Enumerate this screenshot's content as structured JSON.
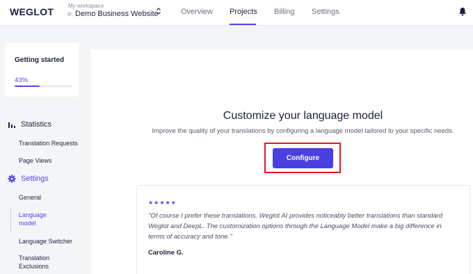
{
  "brand": {
    "logo_text": "WEGLOT"
  },
  "workspace": {
    "caption": "My workspace",
    "name": "Demo Business Website"
  },
  "nav": {
    "tabs": [
      {
        "label": "Overview"
      },
      {
        "label": "Projects"
      },
      {
        "label": "Billing"
      },
      {
        "label": "Settings"
      }
    ],
    "active_tab": "Projects"
  },
  "progress": {
    "title": "Getting started",
    "percent_label": "43%",
    "value": 0.43
  },
  "sidebar": {
    "statistics": {
      "label": "Statistics",
      "icon": "bar-chart-icon",
      "items": [
        {
          "label": "Translation Requests"
        },
        {
          "label": "Page Views"
        }
      ]
    },
    "settings": {
      "label": "Settings",
      "icon": "gear-icon",
      "items": [
        {
          "label": "General"
        },
        {
          "label": "Language model"
        },
        {
          "label": "Language Switcher"
        },
        {
          "label": "Translation Exclusions"
        }
      ]
    }
  },
  "main": {
    "headline": "Customize your language model",
    "subline": "Improve the quality of your translations by configuring a language model tailored to your specific needs.",
    "configure_label": "Configure",
    "testimonial": {
      "stars": "★★★★★",
      "rating": 5,
      "quote": "\"Of course I prefer these translations. Weglot AI provides noticeably better translations than standard Weglot and DeepL. The customization options through the Language Model make a big difference in terms of accuracy and tone.\"",
      "author": "Caroline G."
    }
  },
  "colors": {
    "accent": "#4f46e5",
    "button": "#4a3fe0",
    "highlight": "#e8141b",
    "text": "#1d1f3f"
  }
}
